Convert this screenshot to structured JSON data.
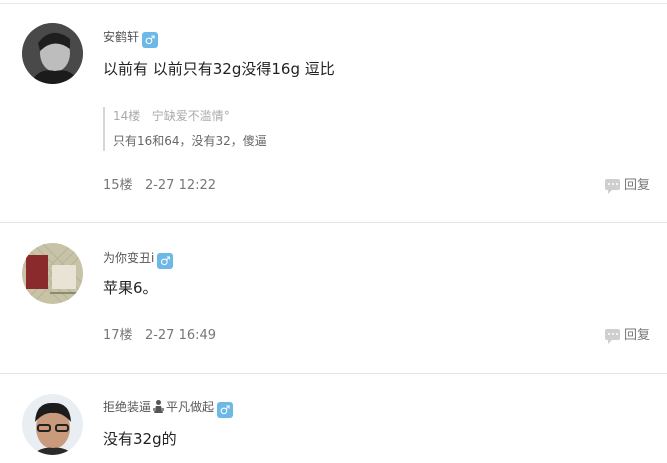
{
  "posts": [
    {
      "username": "安鹤轩",
      "gender_symbol": "♂",
      "content": "以前有  以前只有32g没得16g  逗比",
      "quote": {
        "floor": "14楼",
        "author": "宁缺爱不滥情°",
        "text": "只有16和64，没有32，傻逼"
      },
      "floor": "15楼",
      "time": "2-27 12:22",
      "reply_label": "回复"
    },
    {
      "username": "为你变丑i",
      "gender_symbol": "♂",
      "content": "苹果6。",
      "floor": "17楼",
      "time": "2-27 16:49",
      "reply_label": "回复"
    },
    {
      "username_prefix": "拒绝装逼",
      "username_suffix": "平凡做起",
      "gender_symbol": "♂",
      "content": "没有32g的"
    }
  ],
  "colors": {
    "gender_badge": "#6cb8e6",
    "divider": "#e5e5e5"
  },
  "icons": [
    "avatar-photo",
    "male-icon",
    "speech-bubble-icon",
    "person-emblem-icon"
  ]
}
